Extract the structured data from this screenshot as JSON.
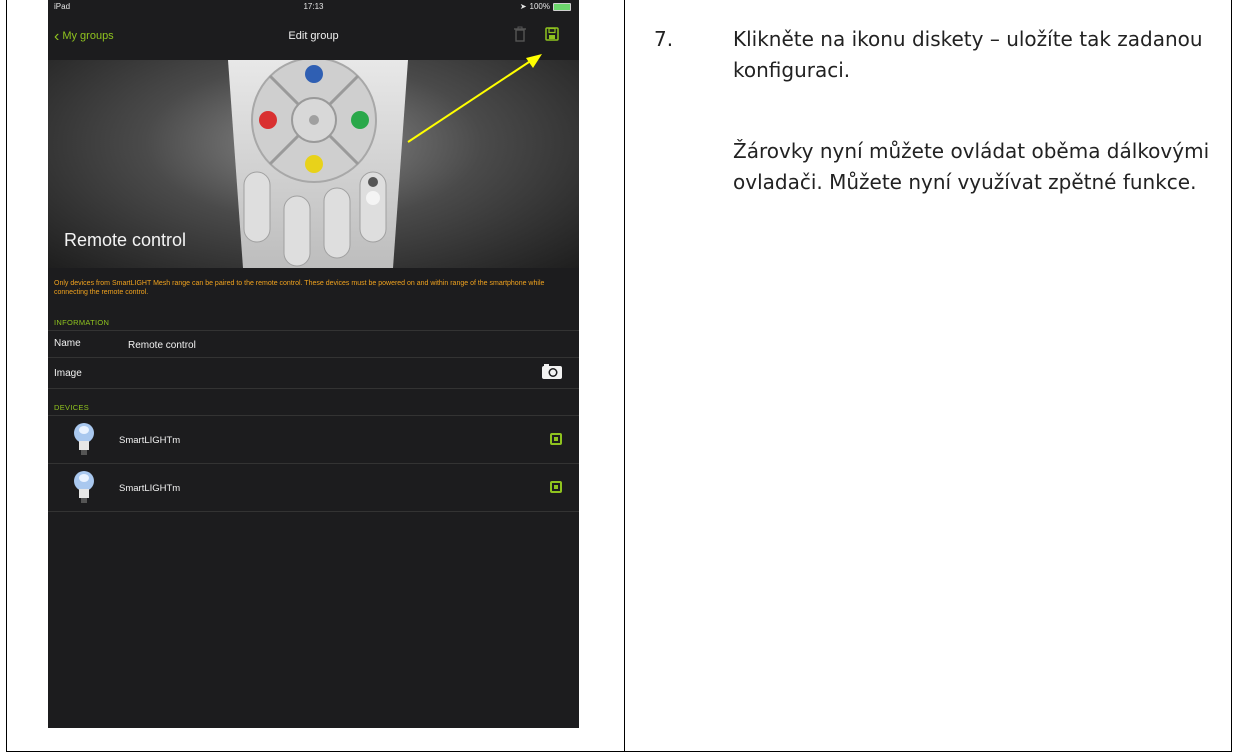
{
  "device_screen": {
    "status_bar": {
      "left": "iPad",
      "time": "17:13",
      "battery": "100%"
    },
    "nav": {
      "back_label": "My groups",
      "title": "Edit group"
    },
    "hero": {
      "title": "Remote control"
    },
    "notice": "Only devices from SmartLIGHT Mesh range can be paired to the remote control. These devices must be powered on and within range of the smartphone while connecting the remote control.",
    "information": {
      "section_label": "INFORMATION",
      "name_key": "Name",
      "name_value": "Remote control",
      "image_key": "Image"
    },
    "devices": {
      "section_label": "DEVICES",
      "items": [
        {
          "name": "SmartLIGHTm"
        },
        {
          "name": "SmartLIGHTm"
        }
      ]
    },
    "accent_color": "#8fc31f",
    "notice_color": "#f0a21e"
  },
  "instructions": {
    "step_number": "7.",
    "step_text": "Klikněte na ikonu diskety – uložíte tak zadanou konfiguraci.",
    "paragraph": "Žárovky nyní můžete ovládat oběma dálkovými ovladači. Můžete nyní využívat zpětné funkce."
  }
}
